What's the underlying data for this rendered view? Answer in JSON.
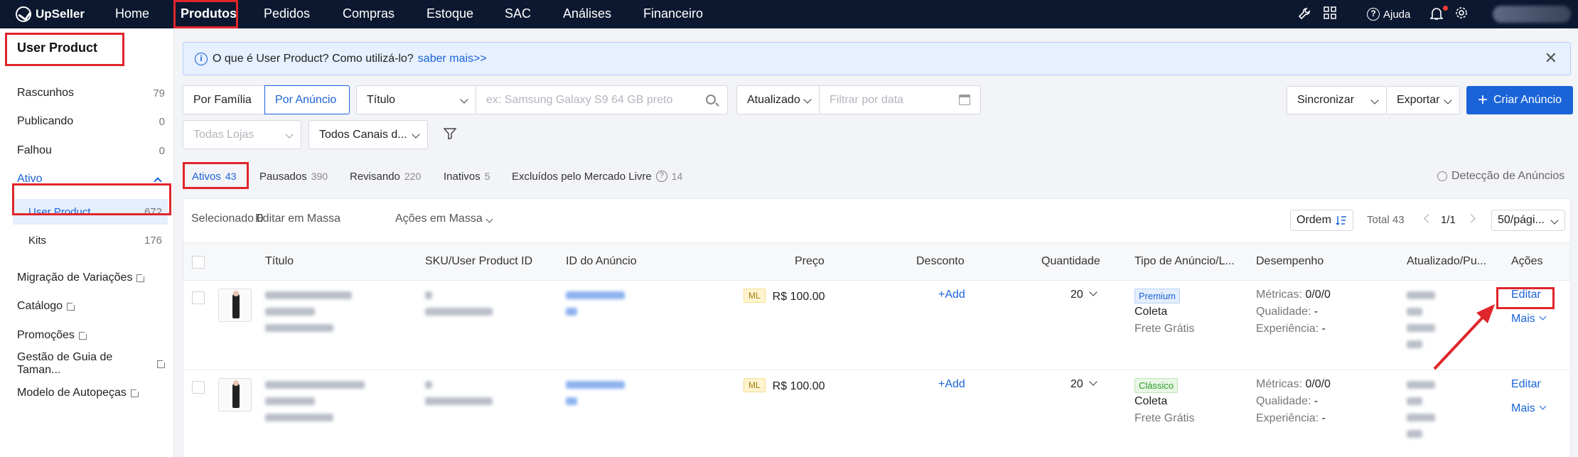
{
  "topbar": {
    "brand": "UpSeller",
    "nav": [
      "Home",
      "Produtos",
      "Pedidos",
      "Compras",
      "Estoque",
      "SAC",
      "Análises",
      "Financeiro"
    ],
    "active_nav": "Produtos",
    "help_label": "Ajuda"
  },
  "sidebar": {
    "title": "User Product",
    "items": [
      {
        "label": "Rascunhos",
        "count": "79"
      },
      {
        "label": "Publicando",
        "count": "0"
      },
      {
        "label": "Falhou",
        "count": "0"
      }
    ],
    "ativo_label": "Ativo",
    "sub_items": [
      {
        "label": "User Product",
        "count": "672"
      },
      {
        "label": "Kits",
        "count": "176"
      }
    ],
    "links": [
      "Migração de Variações",
      "Catálogo",
      "Promoções",
      "Gestão de Guia de Taman...",
      "Modelo de Autopeças"
    ]
  },
  "banner": {
    "text": "O que é User Product? Como utilizá-lo?",
    "link": "saber mais>>",
    "close": "✕"
  },
  "filters": {
    "by_family": "Por Família",
    "by_listing": "Por Anúncio",
    "field_select": "Título",
    "search_placeholder": "ex: Samsung Galaxy S9 64 GB preto",
    "date_select": "Atualizado",
    "date_placeholder": "Filtrar por data",
    "stores_placeholder": "Todas Lojas",
    "channels": "Todos Canais d...",
    "sync": "Sincronizar",
    "export": "Exportar",
    "create": "Criar Anúncio"
  },
  "status_tabs": [
    {
      "label": "Ativos",
      "count": "43"
    },
    {
      "label": "Pausados",
      "count": "390"
    },
    {
      "label": "Revisando",
      "count": "220"
    },
    {
      "label": "Inativos",
      "count": "5"
    },
    {
      "label": "Excluídos pelo Mercado Livre",
      "count": "14"
    }
  ],
  "detect_label": "Detecção de Anúncios",
  "toolbar": {
    "selected_label": "Selecionado",
    "selected_count": "0",
    "bulk_edit": "Editar em Massa",
    "bulk_actions": "Ações em Massa",
    "order": "Ordem",
    "total": "Total 43",
    "page": "1/1",
    "per_page": "50/pági..."
  },
  "columns": [
    "Título",
    "SKU/User Product ID",
    "ID do Anúncio",
    "Preço",
    "Desconto",
    "Quantidade",
    "Tipo de Anúncio/L...",
    "Desempenho",
    "Atualizado/Pu...",
    "Ações"
  ],
  "rows": [
    {
      "channel": "ML",
      "price": "R$ 100.00",
      "discount": "+Add",
      "qty": "20",
      "type": "Premium",
      "shipping": "Coleta",
      "free_shipping": "Frete Grátis",
      "metrics_label": "Métricas:",
      "metrics": "0/0/0",
      "quality_label": "Qualidade:",
      "quality": "-",
      "experience_label": "Experiência:",
      "experience": "-",
      "edit": "Editar",
      "more": "Mais"
    },
    {
      "channel": "ML",
      "price": "R$ 100.00",
      "discount": "+Add",
      "qty": "20",
      "type": "Clássico",
      "shipping": "Coleta",
      "free_shipping": "Frete Grátis",
      "metrics_label": "Métricas:",
      "metrics": "0/0/0",
      "quality_label": "Qualidade:",
      "quality": "-",
      "experience_label": "Experiência:",
      "experience": "-",
      "edit": "Editar",
      "more": "Mais"
    }
  ],
  "colors": {
    "accent": "#1a63d8",
    "topbar": "#0c1830",
    "highlight": "#e0252b"
  }
}
